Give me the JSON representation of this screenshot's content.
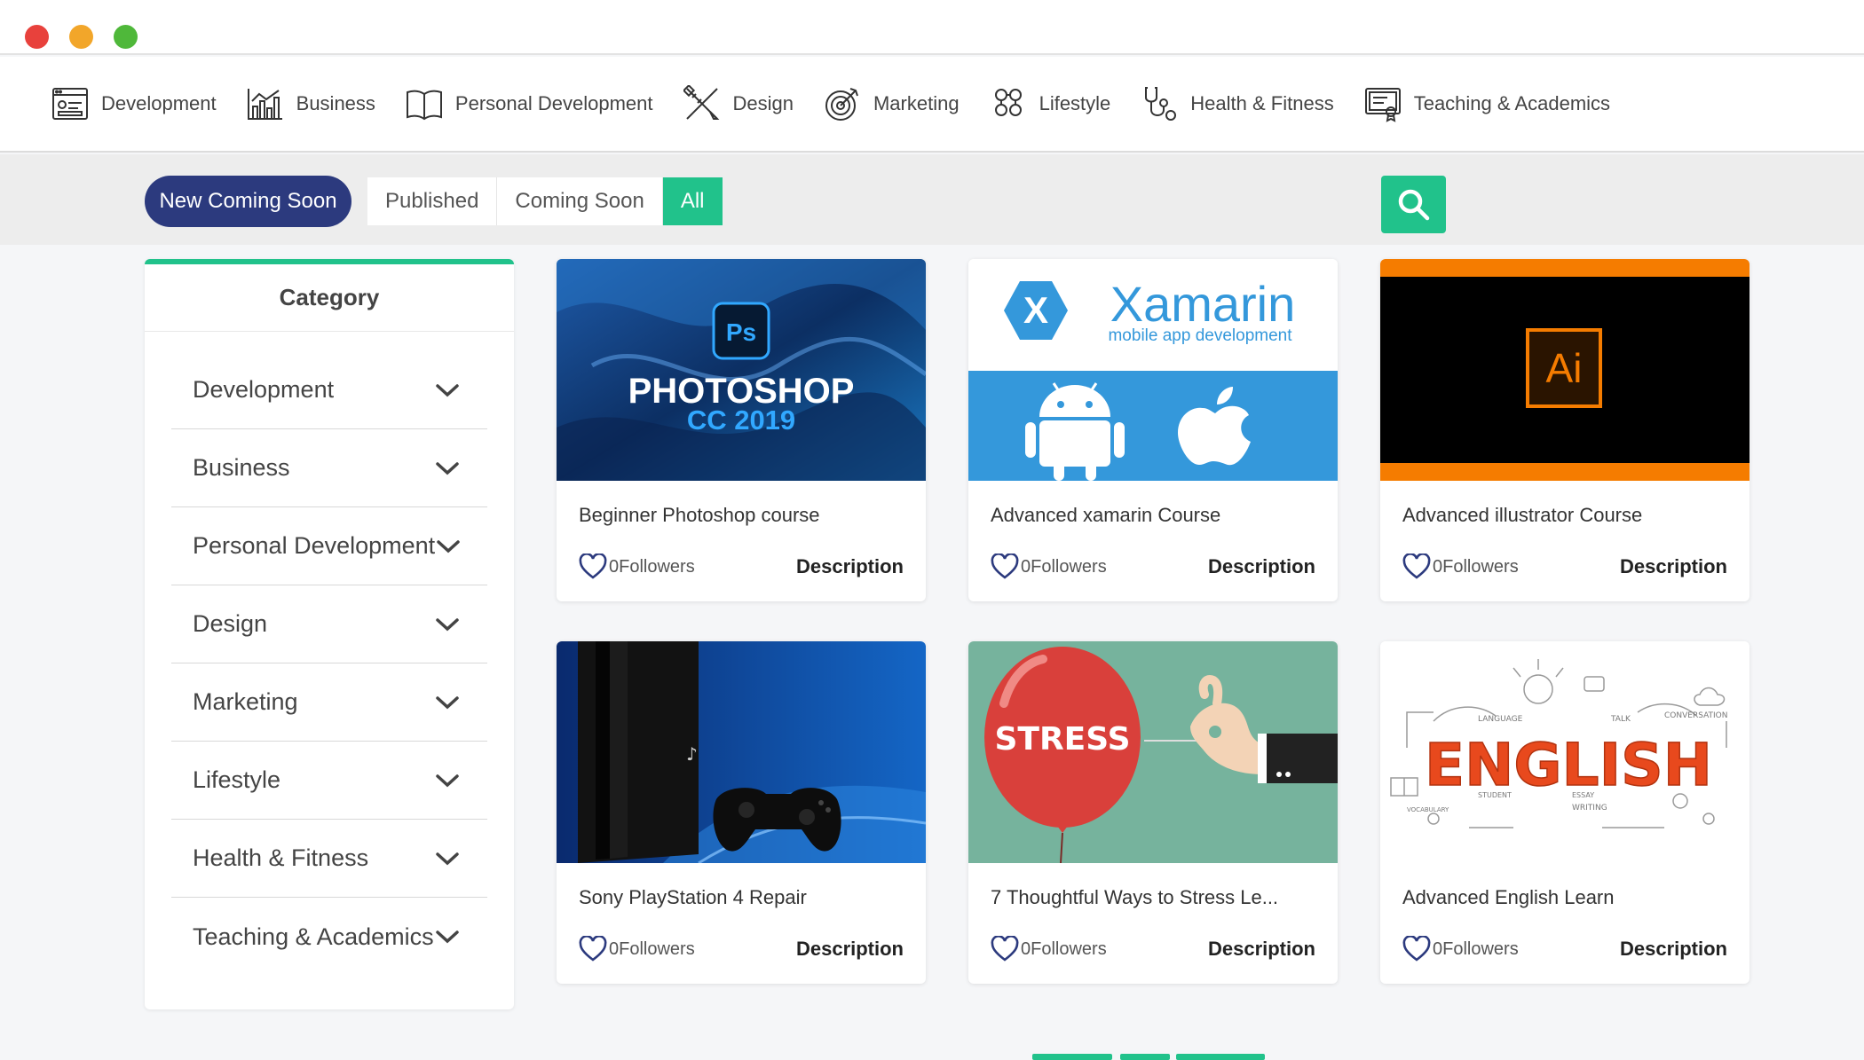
{
  "window": {
    "controls": [
      "close",
      "minimize",
      "maximize"
    ]
  },
  "nav": {
    "items": [
      {
        "label": "Development",
        "icon": "development-icon"
      },
      {
        "label": "Business",
        "icon": "business-chart-icon"
      },
      {
        "label": "Personal Development",
        "icon": "book-icon"
      },
      {
        "label": "Design",
        "icon": "design-tools-icon"
      },
      {
        "label": "Marketing",
        "icon": "target-icon"
      },
      {
        "label": "Lifestyle",
        "icon": "lifestyle-icon"
      },
      {
        "label": "Health & Fitness",
        "icon": "stethoscope-icon"
      },
      {
        "label": "Teaching & Academics",
        "icon": "certificate-icon"
      }
    ]
  },
  "filters": {
    "new_button": "New Coming Soon",
    "tabs": [
      "Published",
      "Coming Soon",
      "All"
    ],
    "active_tab": "All",
    "search_icon": "search-icon"
  },
  "sidebar": {
    "title": "Category",
    "items": [
      "Development",
      "Business",
      "Personal Development",
      "Design",
      "Marketing",
      "Lifestyle",
      "Health & Fitness",
      "Teaching & Academics"
    ]
  },
  "thumbs": {
    "photoshop": {
      "badge": "Ps",
      "line1": "PHOTOSHOP",
      "line2": "CC 2019"
    },
    "xamarin": {
      "logo_letter": "X",
      "name": "Xamarin",
      "tagline": "mobile app development"
    },
    "illustrator": {
      "badge": "Ai"
    },
    "stress": {
      "word": "STRESS"
    },
    "english": {
      "word": "ENGLISH"
    }
  },
  "courses": [
    {
      "title": "Beginner Photoshop course",
      "followers": "0Followers",
      "action": "Description"
    },
    {
      "title": "Advanced xamarin Course",
      "followers": "0Followers",
      "action": "Description"
    },
    {
      "title": "Advanced illustrator Course",
      "followers": "0Followers",
      "action": "Description"
    },
    {
      "title": "Sony PlayStation 4 Repair",
      "followers": "0Followers",
      "action": "Description"
    },
    {
      "title": "7 Thoughtful Ways to Stress Le...",
      "followers": "0Followers",
      "action": "Description"
    },
    {
      "title": "Advanced English Learn",
      "followers": "0Followers",
      "action": "Description"
    }
  ],
  "colors": {
    "accent": "#21c28b",
    "primary": "#2c3a7e",
    "orange": "#f57c00"
  }
}
